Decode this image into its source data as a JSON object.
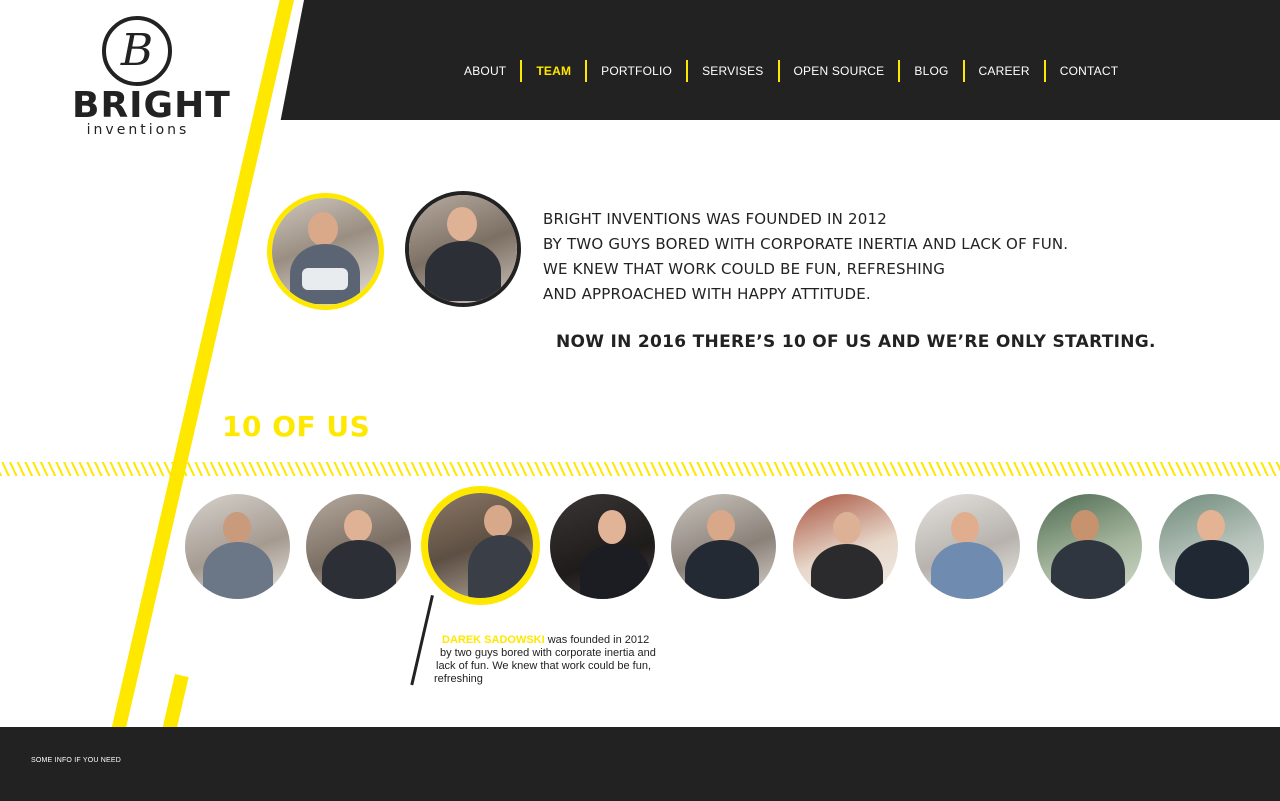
{
  "brand": {
    "mark": "B",
    "name": "BRIGHT",
    "tagline": "inventions"
  },
  "nav": {
    "items": [
      {
        "label": "ABOUT",
        "active": false
      },
      {
        "label": "TEAM",
        "active": true
      },
      {
        "label": "PORTFOLIO",
        "active": false
      },
      {
        "label": "SERVISES",
        "active": false
      },
      {
        "label": "OPEN SOURCE",
        "active": false
      },
      {
        "label": "BLOG",
        "active": false
      },
      {
        "label": "CAREER",
        "active": false
      },
      {
        "label": "CONTACT",
        "active": false
      }
    ]
  },
  "intro": {
    "lines": [
      "BRIGHT INVENTIONS WAS FOUNDED IN 2012",
      "BY TWO GUYS BORED WITH CORPORATE INERTIA AND LACK OF FUN.",
      "WE KNEW THAT WORK COULD BE FUN, REFRESHING",
      "AND APPROACHED WITH HAPPY ATTITUDE."
    ],
    "headline": "NOW IN 2016 THERE’S 10 OF US AND WE’RE ONLY STARTING."
  },
  "team": {
    "title": "10 OF US",
    "members_shown": 9,
    "selected_index": 2,
    "selected_bio": {
      "name": "DAREK SADOWSKI",
      "line1_rest": " was founded in 2012",
      "line2": "by two guys bored with corporate inertia and",
      "line3": "lack of fun. We knew that work could be fun,",
      "line4": "refreshing"
    }
  },
  "footer": {
    "note": "SOME INFO IF YOU NEED"
  },
  "colors": {
    "accent": "#ffe800",
    "dark": "#222222",
    "background": "#ffffff"
  }
}
